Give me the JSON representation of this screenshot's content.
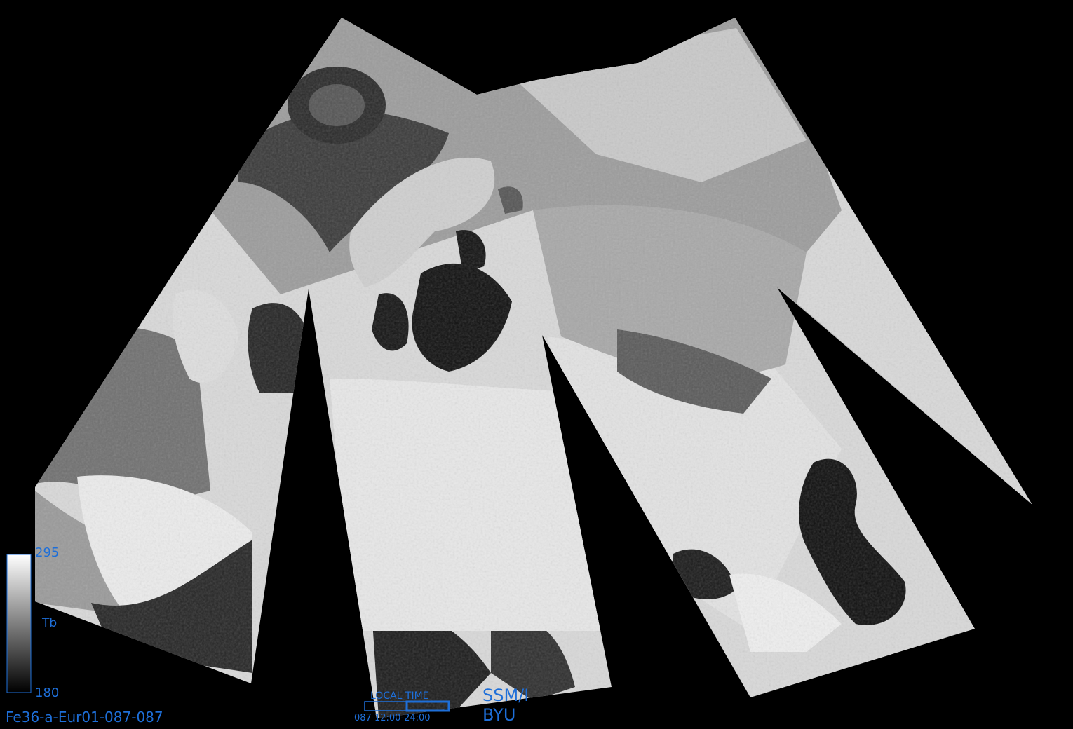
{
  "image": {
    "name": "Fe36-a-Eur01-087-087",
    "sensor": "SSM/I",
    "organization": "BYU"
  },
  "colorbar": {
    "max_label": "295",
    "min_label": "180",
    "variable_label": "Tb",
    "max_value": 295,
    "min_value": 180
  },
  "local_time": {
    "title": "LOCAL TIME",
    "range_label": "087 12:00-24:00",
    "range_start_hour": 12,
    "range_end_hour": 24
  },
  "colors": {
    "background": "#000000",
    "annotation": "#1e6fd9",
    "land_bright": "#e2e2e2",
    "water_dark": "#151515"
  }
}
